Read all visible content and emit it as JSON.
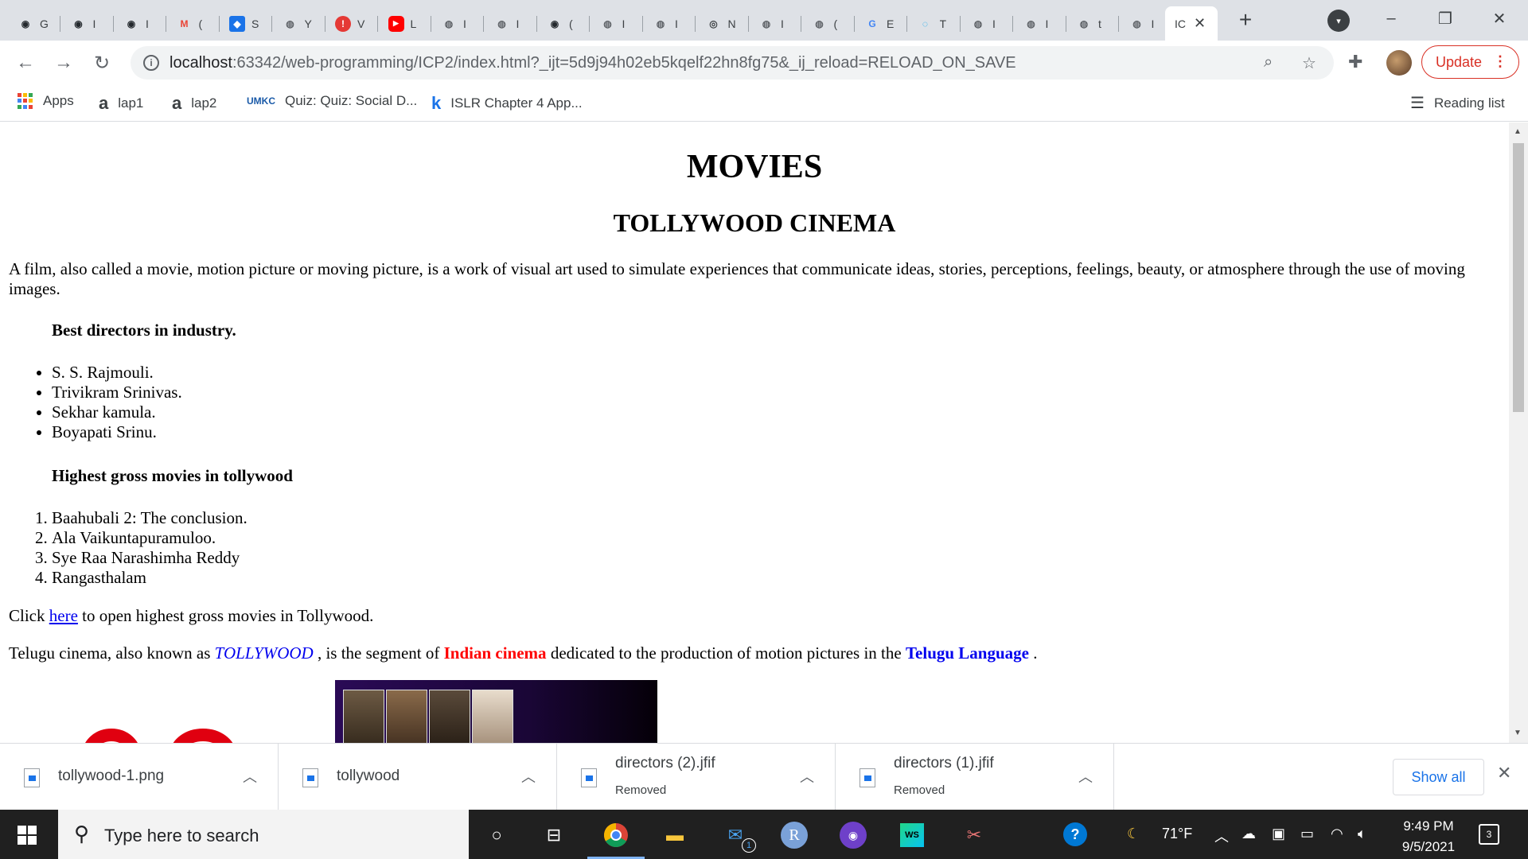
{
  "browser": {
    "tabs": [
      {
        "label": "G",
        "icon": "github-icon",
        "color": "#24292e"
      },
      {
        "label": "I",
        "icon": "github-icon",
        "color": "#24292e"
      },
      {
        "label": "I",
        "icon": "github-icon",
        "color": "#24292e"
      },
      {
        "label": "(",
        "icon": "gmail-icon",
        "color": "#ea4335"
      },
      {
        "label": "S",
        "icon": "app-icon",
        "color": "#1a73e8"
      },
      {
        "label": "Y",
        "icon": "globe-icon",
        "color": "#5f6368"
      },
      {
        "label": "V",
        "icon": "alert-icon",
        "color": "#e53935"
      },
      {
        "label": "L",
        "icon": "youtube-icon",
        "color": "#ff0000"
      },
      {
        "label": "I",
        "icon": "globe-icon",
        "color": "#5f6368"
      },
      {
        "label": "I",
        "icon": "globe-icon",
        "color": "#5f6368"
      },
      {
        "label": "(",
        "icon": "github-icon",
        "color": "#24292e"
      },
      {
        "label": "I",
        "icon": "globe-icon",
        "color": "#5f6368"
      },
      {
        "label": "I",
        "icon": "globe-icon",
        "color": "#5f6368"
      },
      {
        "label": "N",
        "icon": "chromium-icon",
        "color": "#3c4043"
      },
      {
        "label": "I",
        "icon": "globe-icon",
        "color": "#5f6368"
      },
      {
        "label": "(",
        "icon": "globe-icon",
        "color": "#5f6368"
      },
      {
        "label": "E",
        "icon": "google-icon",
        "color": "#4285f4"
      },
      {
        "label": "T",
        "icon": "circle-icon",
        "color": "#00a4ef"
      },
      {
        "label": "I",
        "icon": "globe-icon",
        "color": "#5f6368"
      },
      {
        "label": "I",
        "icon": "globe-icon",
        "color": "#5f6368"
      },
      {
        "label": "t",
        "icon": "globe-icon",
        "color": "#5f6368"
      },
      {
        "label": "I",
        "icon": "globe-icon",
        "color": "#5f6368"
      }
    ],
    "active_tab": {
      "label": "IC"
    },
    "new_tab": "+",
    "url_host": "localhost",
    "url_rest": ":63342/web-programming/ICP2/index.html?_ijt=5d9j94h02eb5kqelf22hn8fg75&_ij_reload=RELOAD_ON_SAVE",
    "update_label": "Update",
    "bookmarks": [
      {
        "label": "Apps",
        "icon": "apps-icon"
      },
      {
        "label": "lap1",
        "icon": "amazon-icon"
      },
      {
        "label": "lap2",
        "icon": "amazon-icon"
      },
      {
        "label": "Quiz: Quiz: Social D...",
        "icon": "umkc-icon"
      },
      {
        "label": "ISLR Chapter 4 App...",
        "icon": "k-icon"
      }
    ],
    "reading_list": "Reading list"
  },
  "page": {
    "title": "MOVIES",
    "subtitle": "TOLLYWOOD CINEMA",
    "intro": "A film, also called a movie, motion picture or moving picture, is a work of visual art used to simulate experiences that communicate ideas, stories, perceptions, feelings, beauty, or atmosphere through the use of moving images.",
    "directors_heading": "Best directors in industry.",
    "directors": [
      "S. S. Rajmouli.",
      "Trivikram Srinivas.",
      "Sekhar kamula.",
      "Boyapati Srinu."
    ],
    "movies_heading": "Highest gross movies in tollywood",
    "movies": [
      "Baahubali 2: The conclusion.",
      "Ala Vaikuntapuramuloo.",
      "Sye Raa Narashimha Reddy",
      "Rangasthalam"
    ],
    "click_pre": "Click ",
    "click_link": "here",
    "click_post": " to open highest gross movies in Tollywood.",
    "telugu_1": "Telugu cinema, also known as ",
    "telugu_tollywood": "TOLLYWOOD",
    "telugu_2": " , is the segment of ",
    "telugu_indian": "Indian cinema",
    "telugu_3": " dedicated to the production of motion pictures in the ",
    "telugu_lang": "Telugu Language",
    "telugu_4": " ."
  },
  "downloads": [
    {
      "name": "tollywood-1.png",
      "status": ""
    },
    {
      "name": "tollywood",
      "status": ""
    },
    {
      "name": "directors (2).jfif",
      "status": "Removed"
    },
    {
      "name": "directors (1).jfif",
      "status": "Removed"
    }
  ],
  "show_all": "Show all",
  "taskbar": {
    "search_placeholder": "Type here to search",
    "weather": "71°F",
    "time": "9:49 PM",
    "date": "9/5/2021",
    "notifications": "3",
    "mail_badge": "1"
  }
}
